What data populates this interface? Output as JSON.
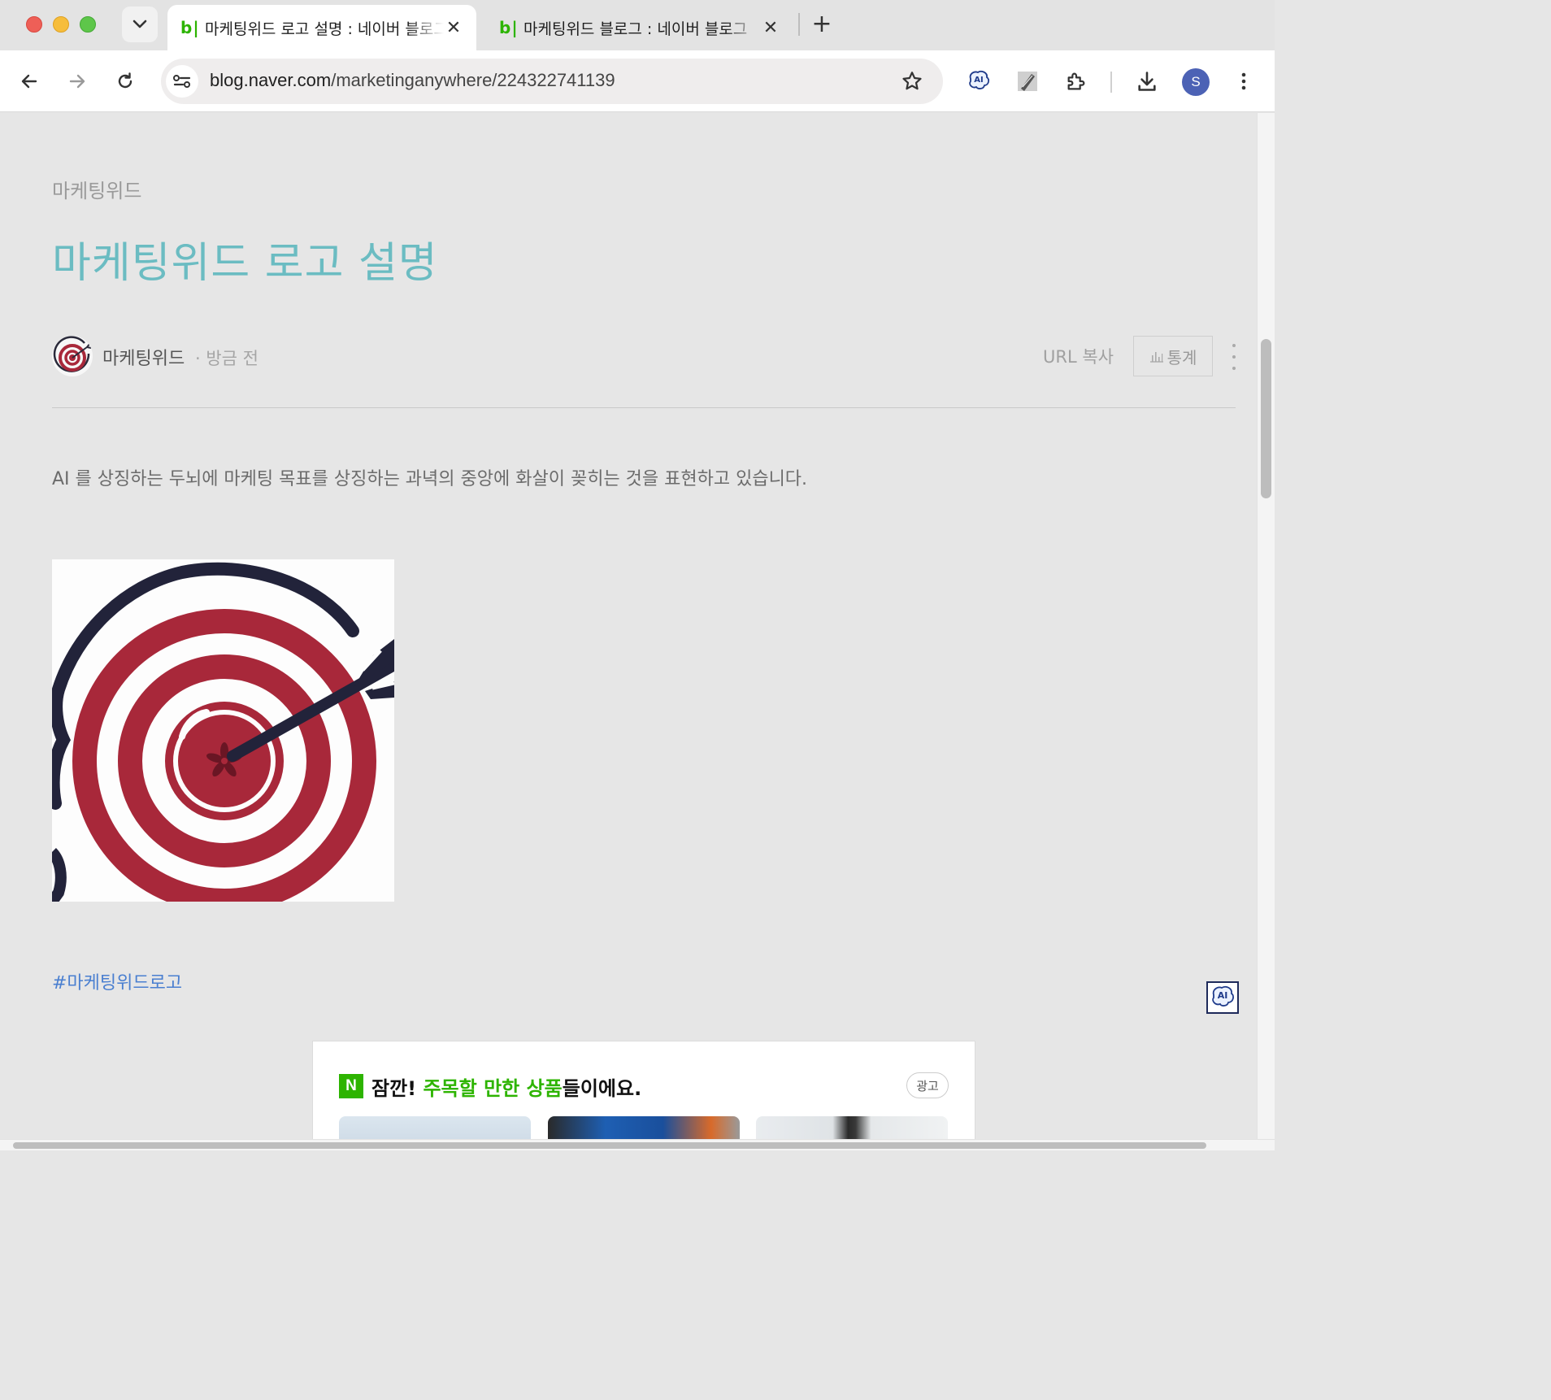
{
  "browser": {
    "tabs": [
      {
        "favicon": "b|",
        "title": "마케팅위드 로고 설명 : 네이버 블로그",
        "active": true
      },
      {
        "favicon": "b|",
        "title": "마케팅위드 블로그 : 네이버 블로그",
        "active": false
      }
    ],
    "url_host": "blog.naver.com",
    "url_path": "/marketinganywhere/224322741139",
    "avatar_letter": "S",
    "icons": [
      "back-icon",
      "forward-icon",
      "reload-icon",
      "site-info-icon",
      "star-icon",
      "ai-extension-icon",
      "pen-tool-icon",
      "extensions-icon",
      "download-icon",
      "menu-icon"
    ]
  },
  "post": {
    "category": "마케팅위드",
    "title": "마케팅위드 로고 설명",
    "author": "마케팅위드",
    "date": "· 방금 전",
    "url_copy": "URL 복사",
    "stats_label": "통계",
    "body": "AI 를 상징하는 두뇌에 마케팅 목표를 상징하는 과녁의 중앙에 화살이 꽂히는 것을 표현하고 있습니다.",
    "hashtag": "#마케팅위드로고"
  },
  "ad": {
    "badge": "N",
    "heading_prefix": "잠깐! ",
    "heading_highlight": "주목할 만한 상품",
    "heading_suffix": "들이에요.",
    "tag": "광고"
  },
  "floating": {
    "label": "AI"
  },
  "colors": {
    "title": "#6bbcc2",
    "hashtag": "#4a7fd0",
    "naver_green": "#2db400",
    "target_red": "#a8283a",
    "avatar_blue": "#4c62b5"
  }
}
